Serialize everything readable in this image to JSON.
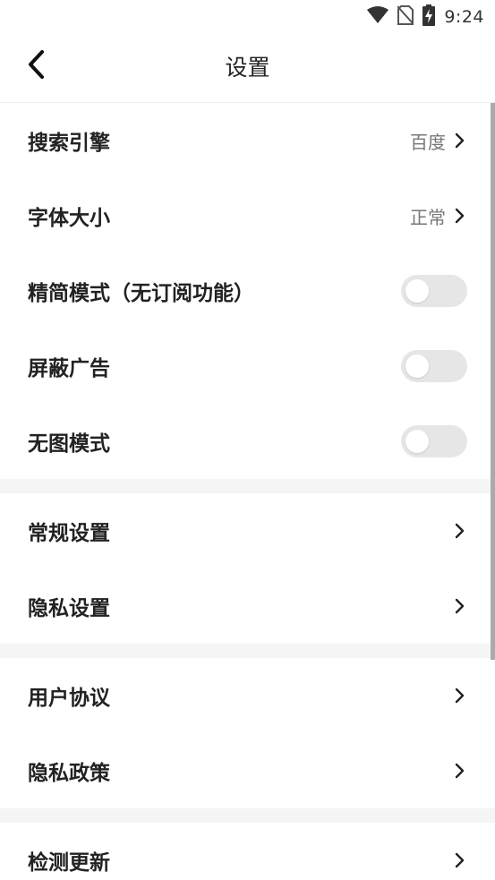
{
  "status_bar": {
    "time": "9:24",
    "icons": [
      "wifi-icon",
      "no-sim-icon",
      "battery-charging-icon"
    ]
  },
  "header": {
    "title": "设置",
    "back_icon": "chevron-left-icon"
  },
  "groups": [
    {
      "items": [
        {
          "label": "搜索引擎",
          "value": "百度",
          "type": "link"
        },
        {
          "label": "字体大小",
          "value": "正常",
          "type": "link"
        },
        {
          "label": "精简模式（无订阅功能）",
          "type": "toggle",
          "on": false
        },
        {
          "label": "屏蔽广告",
          "type": "toggle",
          "on": false
        },
        {
          "label": "无图模式",
          "type": "toggle",
          "on": false
        }
      ]
    },
    {
      "items": [
        {
          "label": "常规设置",
          "type": "link"
        },
        {
          "label": "隐私设置",
          "type": "link"
        }
      ]
    },
    {
      "items": [
        {
          "label": "用户协议",
          "type": "link"
        },
        {
          "label": "隐私政策",
          "type": "link"
        }
      ]
    },
    {
      "items": [
        {
          "label": "检测更新",
          "type": "link"
        }
      ]
    }
  ],
  "colors": {
    "background": "#f5f5f5",
    "toggle_off": "#e6e6e6",
    "secondary_text": "#777777"
  }
}
